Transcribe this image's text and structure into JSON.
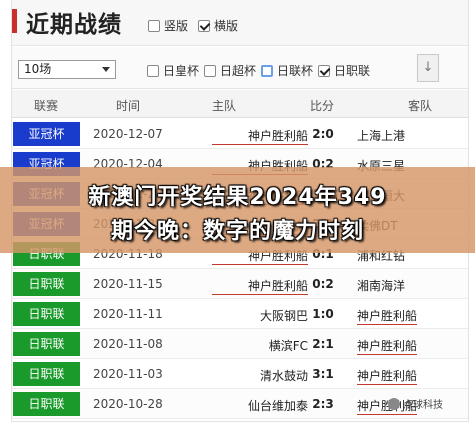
{
  "header": {
    "title": "近期战绩",
    "vertical_label": "竖版",
    "vertical_checked": false,
    "horizontal_label": "横版",
    "horizontal_checked": true
  },
  "filter": {
    "count_select": "10场",
    "leagues": [
      {
        "label": "日皇杯",
        "checked": false
      },
      {
        "label": "日超杯",
        "checked": false
      },
      {
        "label": "日联杯",
        "checked": false
      },
      {
        "label": "日职联",
        "checked": true
      }
    ],
    "scroll_glyph": "↓"
  },
  "columns": {
    "competition": "联赛",
    "time": "时间",
    "home": "主队",
    "score": "比分",
    "away": "客队"
  },
  "rows": [
    {
      "competition": "亚冠杯",
      "color": "#1a3ccc",
      "date": "2020-12-07",
      "home": "神户胜利船",
      "score": "2:0",
      "away": "上海上港",
      "home_hl": true,
      "away_hl": false
    },
    {
      "competition": "亚冠杯",
      "color": "#1a3ccc",
      "date": "2020-12-04",
      "home": "神户胜利船",
      "score": "0:2",
      "away": "水原三星",
      "home_hl": true,
      "away_hl": false
    },
    {
      "competition": "亚冠杯",
      "color": "#1a3ccc",
      "date": "2020-11-28",
      "home": "神户胜利船",
      "score": "1:1",
      "away": "广州恒大",
      "home_hl": true,
      "away_hl": false
    },
    {
      "competition": "亚冠杯",
      "color": "#1a3ccc",
      "date": "2020-11-25",
      "home": "神户胜利船",
      "score": "2:0",
      "away": "柔佛DT",
      "home_hl": true,
      "away_hl": false
    },
    {
      "competition": "日职联",
      "color": "#1a9a2a",
      "date": "2020-11-18",
      "home": "神户胜利船",
      "score": "0:1",
      "away": "浦和红钻",
      "home_hl": true,
      "away_hl": false
    },
    {
      "competition": "日职联",
      "color": "#1a9a2a",
      "date": "2020-11-15",
      "home": "神户胜利船",
      "score": "0:2",
      "away": "湘南海洋",
      "home_hl": true,
      "away_hl": false
    },
    {
      "competition": "日职联",
      "color": "#1a9a2a",
      "date": "2020-11-11",
      "home": "大阪钢巴",
      "score": "1:0",
      "away": "神户胜利船",
      "home_hl": false,
      "away_hl": true
    },
    {
      "competition": "日职联",
      "color": "#1a9a2a",
      "date": "2020-11-08",
      "home": "横滨FC",
      "score": "2:1",
      "away": "神户胜利船",
      "home_hl": false,
      "away_hl": true
    },
    {
      "competition": "日职联",
      "color": "#1a9a2a",
      "date": "2020-11-03",
      "home": "清水鼓动",
      "score": "3:1",
      "away": "神户胜利船",
      "home_hl": false,
      "away_hl": true
    },
    {
      "competition": "日职联",
      "color": "#1a9a2a",
      "date": "2020-10-28",
      "home": "仙台维加泰",
      "score": "2:3",
      "away": "神户胜利船",
      "home_hl": false,
      "away_hl": true
    }
  ],
  "banner": {
    "line1": "新澳门开奖结果2024年349",
    "line2": "期今晚：数字的魔力时刻"
  },
  "watermark": "点球科技"
}
